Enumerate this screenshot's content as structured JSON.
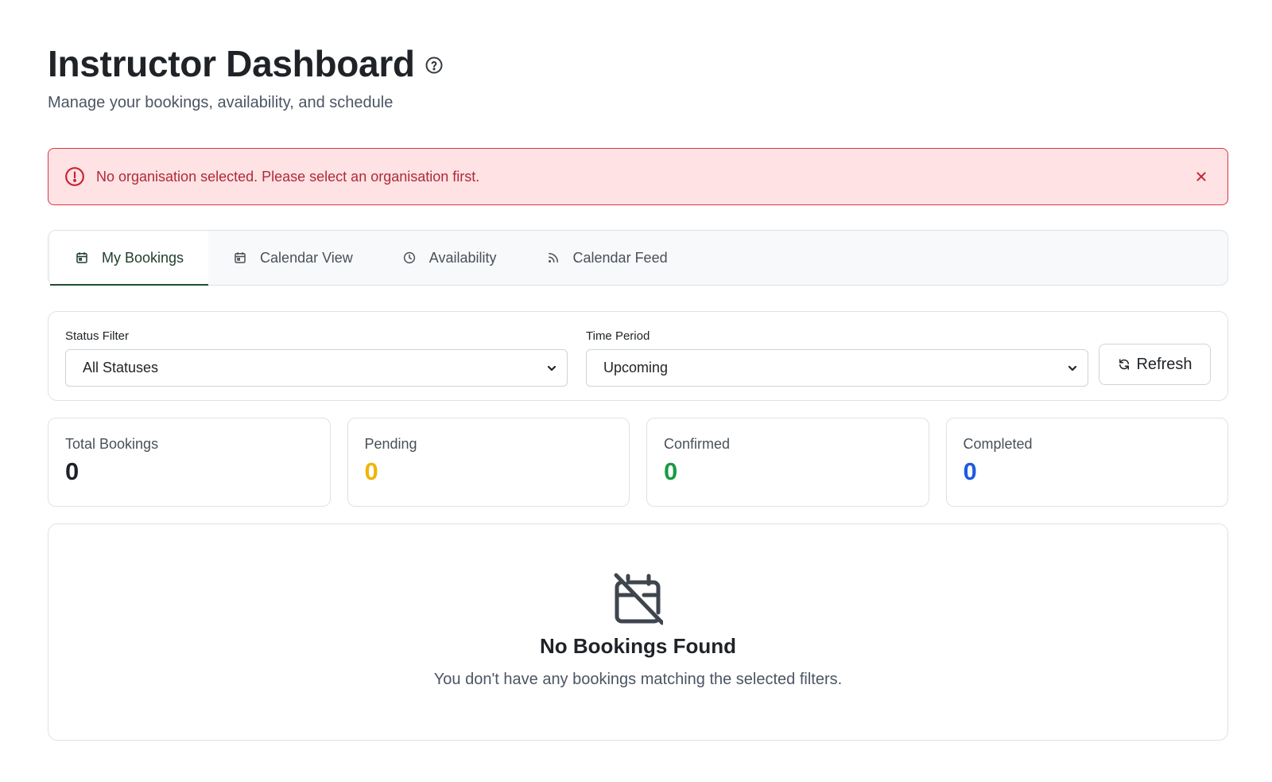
{
  "header": {
    "title": "Instructor Dashboard",
    "subtitle": "Manage your bookings, availability, and schedule",
    "help_icon": "question-circle-icon"
  },
  "alert": {
    "message": "No organisation selected. Please select an organisation first.",
    "icon": "exclamation-circle-icon",
    "close_icon": "close-icon",
    "color": "#dc3545"
  },
  "tabs": [
    {
      "label": "My Bookings",
      "icon": "calendar-icon",
      "active": true
    },
    {
      "label": "Calendar View",
      "icon": "calendar-icon",
      "active": false
    },
    {
      "label": "Availability",
      "icon": "clock-icon",
      "active": false
    },
    {
      "label": "Calendar Feed",
      "icon": "rss-icon",
      "active": false
    }
  ],
  "filters": {
    "status": {
      "label": "Status Filter",
      "value": "All Statuses"
    },
    "period": {
      "label": "Time Period",
      "value": "Upcoming"
    },
    "refresh_label": "Refresh"
  },
  "stats": [
    {
      "label": "Total Bookings",
      "value": "0",
      "color": "#1f2328"
    },
    {
      "label": "Pending",
      "value": "0",
      "color": "#f0b400"
    },
    {
      "label": "Confirmed",
      "value": "0",
      "color": "#1a9b44"
    },
    {
      "label": "Completed",
      "value": "0",
      "color": "#1d5be0"
    }
  ],
  "empty_state": {
    "icon": "calendar-off-icon",
    "title": "No Bookings Found",
    "message": "You don't have any bookings matching the selected filters."
  },
  "colors": {
    "accent": "#1f4d33",
    "alert_bg": "#fee2e4"
  }
}
